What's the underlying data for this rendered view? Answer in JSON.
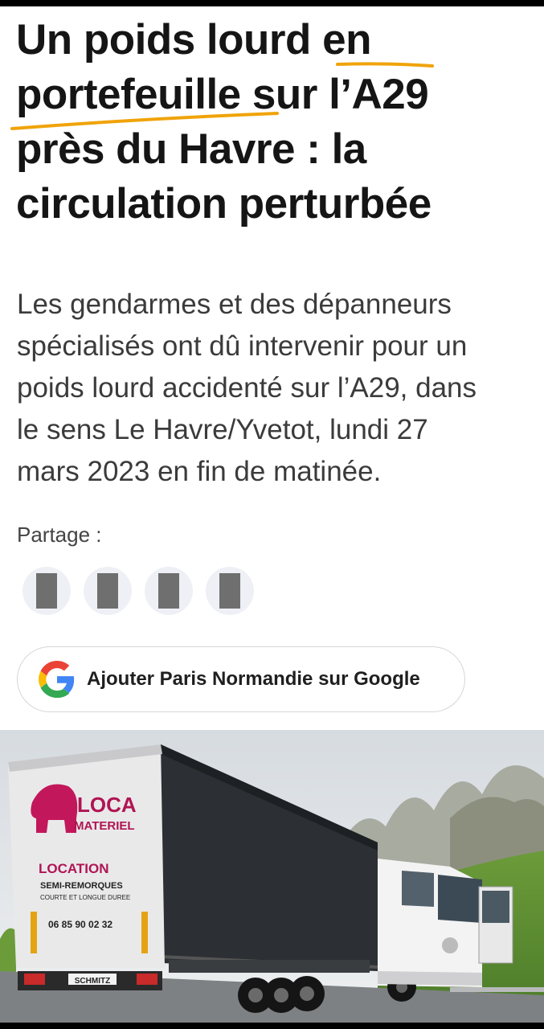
{
  "article": {
    "headline_lines": [
      "Un poids lourd en",
      "portefeuille sur l’A29",
      "près du Havre : la",
      "circulation perturbée"
    ],
    "lede_lines": [
      "Les gendarmes et des dépanneurs",
      "spécialisés ont dû intervenir pour un",
      "poids lourd accidenté sur l’A29, dans",
      "le sens Le Havre/Yvetot, lundi 27",
      "mars 2023 en fin de matinée."
    ]
  },
  "share": {
    "label": "Partage :",
    "buttons": [
      "share-button-1",
      "share-button-2",
      "share-button-3",
      "share-button-4"
    ]
  },
  "google_follow": {
    "label": "Ajouter Paris Normandie sur Google",
    "icon": "google-g-icon"
  },
  "photo": {
    "trailer_brand_line1": "LOCA",
    "trailer_brand_line2": "MATERIEL",
    "trailer_service": "LOCATION",
    "trailer_service_sub": "SEMI-REMORQUES",
    "trailer_service_sub2": "COURTE ET LONGUE DUREE",
    "trailer_phone": "06 85 90 02 32",
    "trailer_maker": "SCHMITZ"
  },
  "colors": {
    "headline": "#151515",
    "lede": "#3b3b3b",
    "highlight_underline": "#f0a30a",
    "share_bg": "#eef0f6",
    "loca_red": "#c2185b"
  }
}
